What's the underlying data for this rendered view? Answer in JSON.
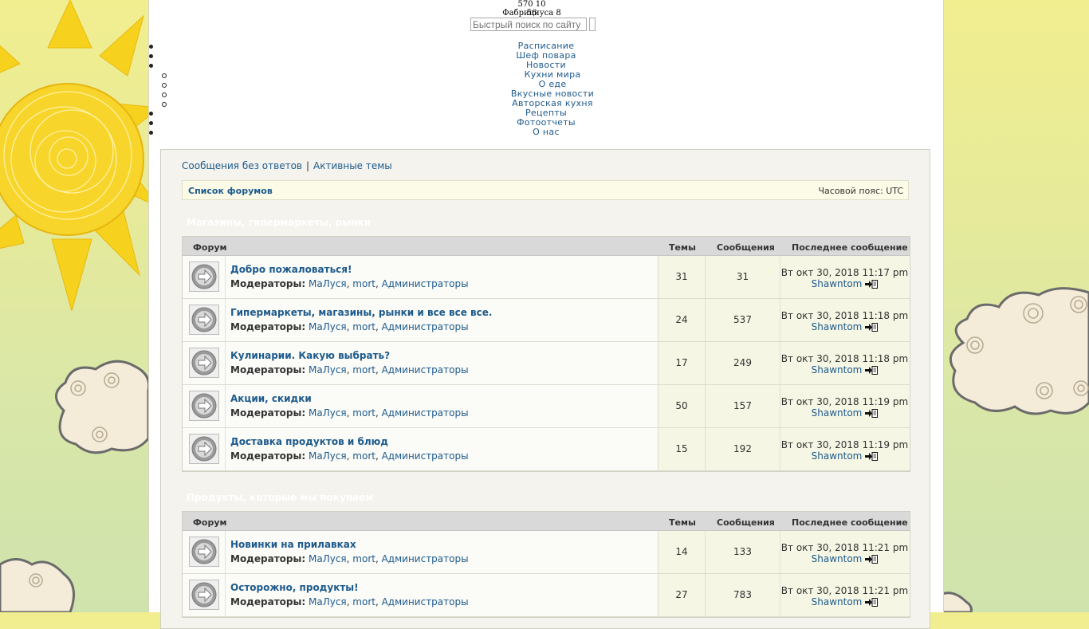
{
  "header": {
    "phone": "570 10 56",
    "address": "Фабрициуса 8",
    "search_placeholder": "Быстрый поиск по сайту"
  },
  "menu": {
    "items": [
      {
        "label": "Расписание"
      },
      {
        "label": "Шеф повара"
      },
      {
        "label": "Новости"
      },
      {
        "label": "Кухни мира"
      },
      {
        "label": "О еде"
      },
      {
        "label": "Вкусные новости"
      },
      {
        "label": "Авторская кухня"
      },
      {
        "label": "Рецепты"
      },
      {
        "label": "Фотоотчеты"
      },
      {
        "label": "О нас"
      }
    ]
  },
  "quick_links": {
    "unanswered": "Сообщения без ответов",
    "separator": "|",
    "active": "Активные темы"
  },
  "navbar": {
    "forum_index": "Список форумов",
    "timezone": "Часовой пояс: UTC"
  },
  "columns": {
    "forum": "Форум",
    "topics": "Темы",
    "posts": "Сообщения",
    "last_post": "Последнее сообщение"
  },
  "moderators_label": "Модераторы:",
  "moderators": [
    "МаЛуся",
    "mort",
    "Администраторы"
  ],
  "categories": [
    {
      "title": "Магазины, гипермаркеты, рынки",
      "forums": [
        {
          "title": "Добро пожаловаться!",
          "topics": "31",
          "posts": "31",
          "last_date": "Вт окт 30, 2018 11:17 pm",
          "last_user": "Shawntom"
        },
        {
          "title": "Гипермаркеты, магазины, рынки и все все все.",
          "topics": "24",
          "posts": "537",
          "last_date": "Вт окт 30, 2018 11:18 pm",
          "last_user": "Shawntom"
        },
        {
          "title": "Кулинарии. Какую выбрать?",
          "topics": "17",
          "posts": "249",
          "last_date": "Вт окт 30, 2018 11:18 pm",
          "last_user": "Shawntom"
        },
        {
          "title": "Акции, скидки",
          "topics": "50",
          "posts": "157",
          "last_date": "Вт окт 30, 2018 11:19 pm",
          "last_user": "Shawntom"
        },
        {
          "title": "Доставка продуктов и блюд",
          "topics": "15",
          "posts": "192",
          "last_date": "Вт окт 30, 2018 11:19 pm",
          "last_user": "Shawntom"
        }
      ]
    },
    {
      "title": "Продукты, которые мы покупаем",
      "forums": [
        {
          "title": "Новинки на прилавках",
          "topics": "14",
          "posts": "133",
          "last_date": "Вт окт 30, 2018 11:21 pm",
          "last_user": "Shawntom"
        },
        {
          "title": "Осторожно, продукты!",
          "topics": "27",
          "posts": "783",
          "last_date": "Вт окт 30, 2018 11:21 pm",
          "last_user": "Shawntom"
        }
      ]
    }
  ]
}
